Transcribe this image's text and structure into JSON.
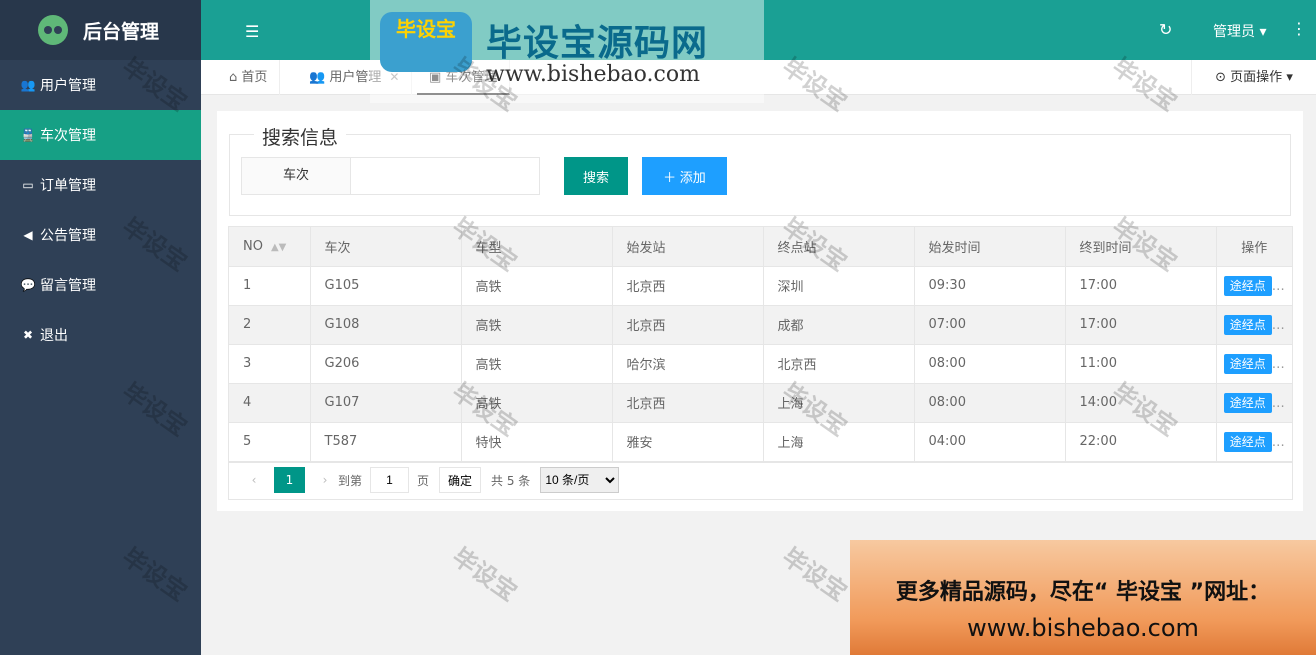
{
  "app": {
    "title": "后台管理"
  },
  "sidebar": {
    "items": [
      {
        "label": "用户管理",
        "icon": "users-icon",
        "glyph": "👥",
        "active": false
      },
      {
        "label": "车次管理",
        "icon": "train-icon",
        "glyph": "🚆",
        "active": true
      },
      {
        "label": "订单管理",
        "icon": "card-icon",
        "glyph": "▭",
        "active": false
      },
      {
        "label": "公告管理",
        "icon": "volume-icon",
        "glyph": "◀",
        "active": false
      },
      {
        "label": "留言管理",
        "icon": "comments-icon",
        "glyph": "💬",
        "active": false
      },
      {
        "label": "退出",
        "icon": "close-box-icon",
        "glyph": "✖",
        "active": false
      }
    ]
  },
  "header": {
    "user": "管理员"
  },
  "tabs": [
    {
      "label": "首页"
    },
    {
      "label": "用户管理"
    },
    {
      "label": "车次管理"
    }
  ],
  "page_op": "页面操作",
  "search": {
    "legend": "搜索信息",
    "field_label": "车次",
    "input_value": "",
    "search_button": "搜索",
    "add_button": "添加"
  },
  "table": {
    "headers": [
      "NO",
      "车次",
      "车型",
      "始发站",
      "终点站",
      "始发时间",
      "终到时间",
      "操作"
    ],
    "action_label": "途经点",
    "rows": [
      [
        "1",
        "G105",
        "高铁",
        "北京西",
        "深圳",
        "09:30",
        "17:00"
      ],
      [
        "2",
        "G108",
        "高铁",
        "北京西",
        "成都",
        "07:00",
        "17:00"
      ],
      [
        "3",
        "G206",
        "高铁",
        "哈尔滨",
        "北京西",
        "08:00",
        "11:00"
      ],
      [
        "4",
        "G107",
        "高铁",
        "北京西",
        "上海",
        "08:00",
        "14:00"
      ],
      [
        "5",
        "T587",
        "特快",
        "雅安",
        "上海",
        "04:00",
        "22:00"
      ]
    ]
  },
  "pager": {
    "current": "1",
    "goto_prefix": "到第",
    "goto_value": "1",
    "goto_suffix": "页",
    "confirm": "确定",
    "total": "共 5 条",
    "page_size": "10 条/页"
  },
  "watermark": {
    "text": "毕设宝",
    "banner_badge": "毕设宝",
    "banner_title": "毕设宝源码网",
    "banner_url": "www.bishebao.com",
    "corner_line1": "更多精品源码，尽在“ 毕设宝 ”网址：",
    "corner_line2": "www.bishebao.com"
  }
}
